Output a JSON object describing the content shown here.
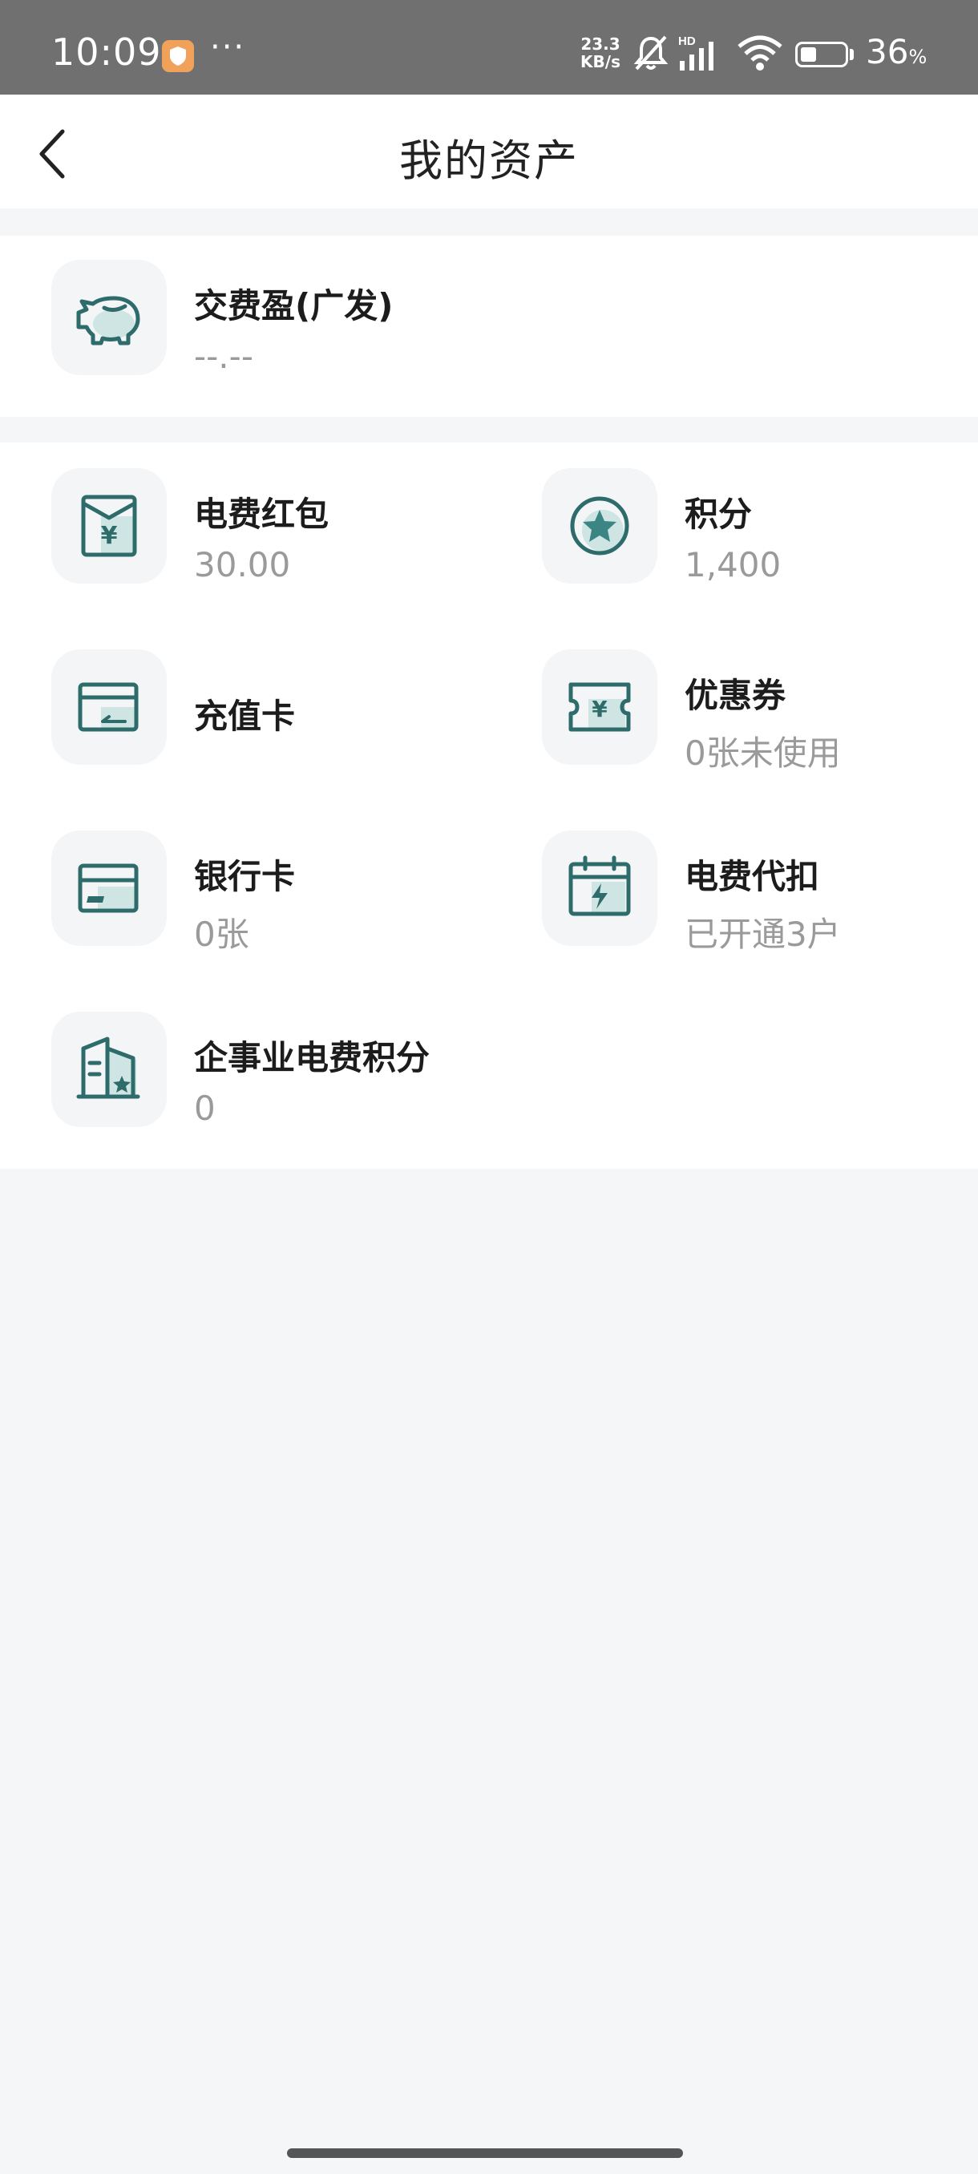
{
  "status_bar": {
    "time": "10:09",
    "more": "···",
    "net_speed_value": "23.3",
    "net_speed_unit": "KB/s",
    "hd_label": "HD",
    "battery_percent": 36,
    "battery_text": "36",
    "battery_symbol": "%"
  },
  "header": {
    "title": "我的资产",
    "back_icon": "chevron-left-icon"
  },
  "fund": {
    "title": "交费盈(广发)",
    "value": "--.--",
    "icon": "piggy-bank-icon"
  },
  "assets": {
    "items": [
      {
        "title": "电费红包",
        "value": "30.00",
        "icon": "red-envelope-icon"
      },
      {
        "title": "积分",
        "value": "1,400",
        "icon": "star-points-icon"
      },
      {
        "title": "充值卡",
        "value": "",
        "icon": "recharge-card-icon"
      },
      {
        "title": "优惠券",
        "value": "0张未使用",
        "icon": "coupon-icon"
      },
      {
        "title": "银行卡",
        "value": "0张",
        "icon": "bank-card-icon"
      },
      {
        "title": "电费代扣",
        "value": "已开通3户",
        "icon": "calendar-bolt-icon"
      },
      {
        "title": "企事业电费积分",
        "value": "0",
        "icon": "building-star-icon"
      }
    ]
  },
  "colors": {
    "accent": "#2e6b6b",
    "accent_light": "#cfe5e3",
    "status_bar_bg": "#707070",
    "page_bg": "#f5f6f8"
  }
}
